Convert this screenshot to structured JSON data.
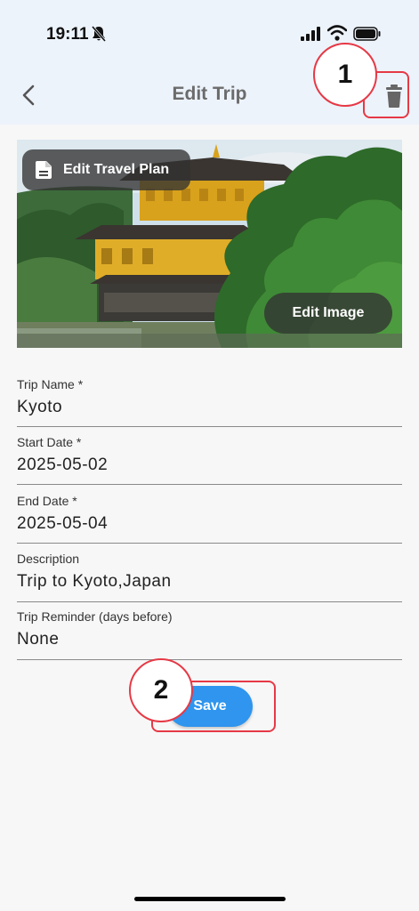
{
  "status_bar": {
    "time": "19:11",
    "icons": [
      "bell-off-icon",
      "signal-icon",
      "wifi-icon",
      "battery-icon"
    ]
  },
  "app_bar": {
    "title": "Edit Trip",
    "icons": [
      "back-chevron-icon",
      "trash-icon"
    ]
  },
  "hero": {
    "edit_plan_label": "Edit Travel Plan",
    "edit_image_label": "Edit Image"
  },
  "form": {
    "fields": [
      {
        "label": "Trip Name *",
        "value": "Kyoto"
      },
      {
        "label": "Start Date *",
        "value": "2025-05-02"
      },
      {
        "label": "End Date *",
        "value": "2025-05-04"
      },
      {
        "label": "Description",
        "value": "Trip to Kyoto,Japan"
      },
      {
        "label": "Trip Reminder (days before)",
        "value": "None"
      }
    ],
    "save_label": "Save"
  },
  "annotations": {
    "marker_1": "1",
    "marker_2": "2"
  },
  "colors": {
    "accent": "#2f95ee",
    "annotation": "#e63946",
    "header_bg": "#edf3fb"
  }
}
